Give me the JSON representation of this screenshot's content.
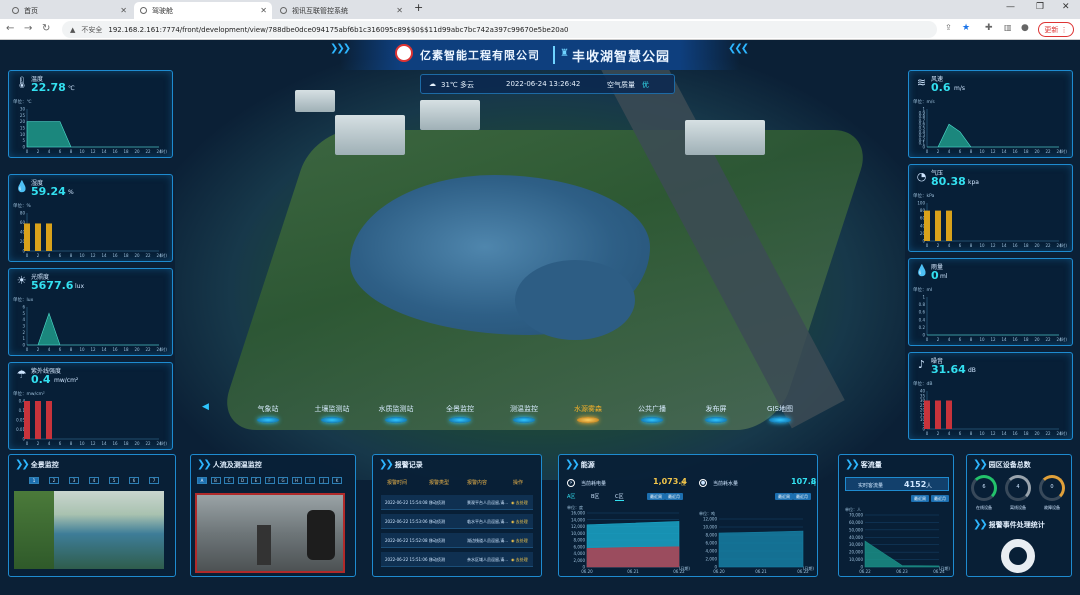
{
  "browser": {
    "tabs": [
      {
        "label": "首页"
      },
      {
        "label": "驾驶舱"
      },
      {
        "label": "视讯互联管控系统"
      }
    ],
    "new_tab": "+",
    "security": "不安全",
    "url": "192.168.2.161:7774/front/development/view/788dbe0dce094175abf6b1c316095c89$$0$$11d99abc7bc742a397c99670e5be20a0",
    "update_label": "更新"
  },
  "header": {
    "company": "亿素智能工程有限公司",
    "park": "丰收湖智慧公园",
    "weather": "31℃ 多云",
    "datetime": "2022-06-24 13:26:42",
    "air_label": "空气质量",
    "air_value": "优"
  },
  "left_panels": [
    {
      "title": "温度",
      "value": "22.78",
      "unit": "℃",
      "axis": "单位：℃",
      "icon": "thermometer-icon",
      "chart": {
        "type": "area",
        "x": [
          "0",
          "2",
          "4",
          "6",
          "8",
          "10",
          "12",
          "14",
          "16",
          "18",
          "20",
          "22",
          "24"
        ],
        "values": [
          20,
          20,
          20,
          20,
          0,
          0,
          0,
          0,
          0,
          0,
          0,
          0,
          0
        ],
        "ylim": [
          0,
          30
        ],
        "yticks": [
          "30",
          "25",
          "20",
          "15",
          "10",
          "5",
          "0"
        ],
        "xunit": "(时)"
      }
    },
    {
      "title": "湿度",
      "value": "59.24",
      "unit": "%",
      "axis": "单位：%",
      "icon": "droplet-icon",
      "chart": {
        "type": "bar",
        "x": [
          "0",
          "2",
          "4",
          "6",
          "8",
          "10",
          "12",
          "14",
          "16",
          "18",
          "20",
          "22",
          "24"
        ],
        "values": [
          58,
          58,
          58,
          0,
          0,
          0,
          0,
          0,
          0,
          0,
          0,
          0,
          0
        ],
        "ylim": [
          0,
          80
        ],
        "yticks": [
          "80",
          "60",
          "40",
          "20",
          "0"
        ],
        "xunit": "(时)"
      }
    },
    {
      "title": "光照度",
      "value": "5677.6",
      "unit": "lux",
      "axis": "单位：lux",
      "icon": "sun-icon",
      "chart": {
        "type": "area",
        "x": [
          "0",
          "2",
          "4",
          "6",
          "8",
          "10",
          "12",
          "14",
          "16",
          "18",
          "20",
          "22",
          "24"
        ],
        "values": [
          0,
          0,
          5,
          0,
          0,
          0,
          0,
          0,
          0,
          0,
          0,
          0,
          0
        ],
        "ylim": [
          0,
          6
        ],
        "yticks": [
          "6",
          "5",
          "4",
          "3",
          "2",
          "1",
          "0"
        ],
        "xunit": "(时)"
      }
    },
    {
      "title": "紫外线强度",
      "value": "0.4",
      "unit": "mw/cm²",
      "axis": "单位：mw/cm²",
      "icon": "umbrella-icon",
      "chart": {
        "type": "bar",
        "x": [
          "0",
          "2",
          "4",
          "6",
          "8",
          "10",
          "12",
          "14",
          "16",
          "18",
          "20",
          "22",
          "24"
        ],
        "values": [
          0.4,
          0.4,
          0.4,
          0,
          0,
          0,
          0,
          0,
          0,
          0,
          0,
          0,
          0
        ],
        "ylim": [
          0,
          0.4
        ],
        "yticks": [
          "0.4",
          "0.1",
          "0.05",
          "0.01",
          "0"
        ],
        "xunit": "(时)"
      }
    }
  ],
  "right_panels": [
    {
      "title": "风速",
      "value": "0.6",
      "unit": "m/s",
      "axis": "单位：m/s",
      "icon": "wind-icon",
      "chart": {
        "type": "area",
        "x": [
          "0",
          "2",
          "4",
          "6",
          "8",
          "10",
          "12",
          "14",
          "16",
          "18",
          "20",
          "22",
          "24"
        ],
        "values": [
          0,
          0,
          0.6,
          0.4,
          0,
          0,
          0,
          0,
          0,
          0,
          0,
          0,
          0
        ],
        "ylim": [
          0,
          1
        ],
        "yticks": [
          "1",
          "0.9",
          "0.8",
          "0.7",
          "0.6",
          "0.5",
          "0.4",
          "0.3",
          "0.2",
          "0.1",
          "0"
        ],
        "xunit": "(时)"
      }
    },
    {
      "title": "气压",
      "value": "80.38",
      "unit": "kpa",
      "axis": "单位：kPa",
      "icon": "gauge-icon",
      "chart": {
        "type": "bar",
        "x": [
          "0",
          "2",
          "4",
          "6",
          "8",
          "10",
          "12",
          "14",
          "16",
          "18",
          "20",
          "22",
          "24"
        ],
        "values": [
          80,
          80,
          80,
          0,
          0,
          0,
          0,
          0,
          0,
          0,
          0,
          0,
          0
        ],
        "ylim": [
          0,
          100
        ],
        "yticks": [
          "100",
          "80",
          "60",
          "40",
          "20",
          "0"
        ],
        "xunit": "(时)"
      }
    },
    {
      "title": "雨量",
      "value": "0",
      "unit": "ml",
      "axis": "单位：ml",
      "icon": "raindrop-icon",
      "chart": {
        "type": "area",
        "x": [
          "0",
          "2",
          "4",
          "6",
          "8",
          "10",
          "12",
          "14",
          "16",
          "18",
          "20",
          "22",
          "24"
        ],
        "values": [
          0,
          0,
          0,
          0,
          0,
          0,
          0,
          0,
          0,
          0,
          0,
          0,
          0
        ],
        "ylim": [
          0,
          1
        ],
        "yticks": [
          "1",
          "0.8",
          "0.6",
          "0.4",
          "0.2",
          "0"
        ],
        "xunit": "(时)"
      }
    },
    {
      "title": "噪音",
      "value": "31.64",
      "unit": "dB",
      "axis": "单位：dB",
      "icon": "sound-icon",
      "chart": {
        "type": "bar",
        "x": [
          "0",
          "2",
          "4",
          "6",
          "8",
          "10",
          "12",
          "14",
          "16",
          "18",
          "20",
          "22",
          "24"
        ],
        "values": [
          30,
          30,
          30,
          0,
          0,
          0,
          0,
          0,
          0,
          0,
          0,
          0,
          0
        ],
        "ylim": [
          0,
          40
        ],
        "yticks": [
          "40",
          "35",
          "30",
          "25",
          "20",
          "15",
          "10",
          "5",
          "0"
        ],
        "xunit": "(时)"
      }
    }
  ],
  "menu": [
    {
      "label": "气象站",
      "active": false
    },
    {
      "label": "土壤监测站",
      "active": false
    },
    {
      "label": "水质监测站",
      "active": false
    },
    {
      "label": "全景监控",
      "active": false
    },
    {
      "label": "测温监控",
      "active": false
    },
    {
      "label": "水源雾森",
      "active": true
    },
    {
      "label": "公共广播",
      "active": false
    },
    {
      "label": "发布屏",
      "active": false
    },
    {
      "label": "GIS地图",
      "active": false
    }
  ],
  "bottom": {
    "panorama": {
      "title": "全景监控",
      "tabs": [
        "1",
        "2",
        "3",
        "4",
        "5",
        "6",
        "7"
      ]
    },
    "crowd": {
      "title": "人流及测温监控",
      "tabs": [
        "A",
        "B",
        "C",
        "D",
        "E",
        "F",
        "G",
        "H",
        "I",
        "J",
        "K"
      ]
    },
    "alarm": {
      "title": "报警记录",
      "headers": [
        "报警时间",
        "报警类型",
        "报警内容",
        "操作"
      ],
      "rows": [
        {
          "time": "2022-06-22 15:54:08",
          "type": "移动侦测",
          "content": "景观平台人员逗留,请...",
          "action": "去处理"
        },
        {
          "time": "2022-06-22 15:53:06",
          "type": "移动侦测",
          "content": "临水平台人员逗留,请...",
          "action": "去处理"
        },
        {
          "time": "2022-06-22 15:52:08",
          "type": "移动侦测",
          "content": "湖边栈道人员逗留,请...",
          "action": "去处理"
        },
        {
          "time": "2022-06-22 15:51:06",
          "type": "移动侦测",
          "content": "亲水区域人员逗留,请...",
          "action": "去处理"
        }
      ]
    },
    "energy": {
      "title": "能源",
      "power_label": "当前耗电量",
      "power_value": "1,073.4",
      "power_unit": "度",
      "water_label": "当前耗水量",
      "water_value": "107.8",
      "water_unit": "吨",
      "zones": [
        "A区",
        "B区",
        "C区"
      ],
      "btn_week": "最近周",
      "btn_month": "最近月",
      "power_axis": "单位：度",
      "water_axis": "单位：吨",
      "power_chart": {
        "type": "area",
        "x": [
          "06.20",
          "06.21",
          "06.22"
        ],
        "y_ticks": [
          "16,000",
          "14,000",
          "12,000",
          "10,000",
          "8,000",
          "6,000",
          "4,000",
          "2,000",
          "0"
        ],
        "series": [
          {
            "name": "A区",
            "values": [
              12500,
              13000,
              13500
            ]
          },
          {
            "name": "C区",
            "values": [
              5500,
              5800,
              6000
            ]
          }
        ],
        "ylim": [
          0,
          16000
        ],
        "xunit": "(日期)"
      },
      "water_chart": {
        "type": "area",
        "x": [
          "06.20",
          "06.21",
          "06.22"
        ],
        "y_ticks": [
          "12,000",
          "10,000",
          "8,000",
          "6,000",
          "4,000",
          "2,000",
          "0"
        ],
        "values": [
          8500,
          8700,
          9000
        ],
        "ylim": [
          0,
          12000
        ],
        "xunit": "(日期)"
      }
    },
    "visitors": {
      "title": "客流量",
      "realtime_label": "实时客流量",
      "realtime_value": "4152",
      "realtime_unit": "人",
      "btn_week": "最近周",
      "btn_month": "最近月",
      "axis": "单位：人",
      "chart": {
        "type": "area",
        "x": [
          "06.22",
          "06.23",
          "06.24"
        ],
        "yticks": [
          "70,000",
          "60,000",
          "50,000",
          "40,000",
          "30,000",
          "20,000",
          "10,000",
          "0"
        ],
        "values": [
          35000,
          2000,
          1500
        ],
        "ylim": [
          0,
          70000
        ],
        "xunit": "(日期)"
      }
    },
    "device": {
      "title": "园区设备总数",
      "rings": [
        {
          "label": "在线设备",
          "value": "6"
        },
        {
          "label": "离线设备",
          "value": "4"
        },
        {
          "label": "故障设备",
          "value": "0"
        }
      ],
      "alarm_title": "报警事件处理统计"
    }
  },
  "colors": {
    "accent": "#2ec6ff",
    "value": "#33e0f0",
    "bar": "#d9a21b",
    "bar_red": "#c8333b",
    "area": "#1e9a8a"
  }
}
